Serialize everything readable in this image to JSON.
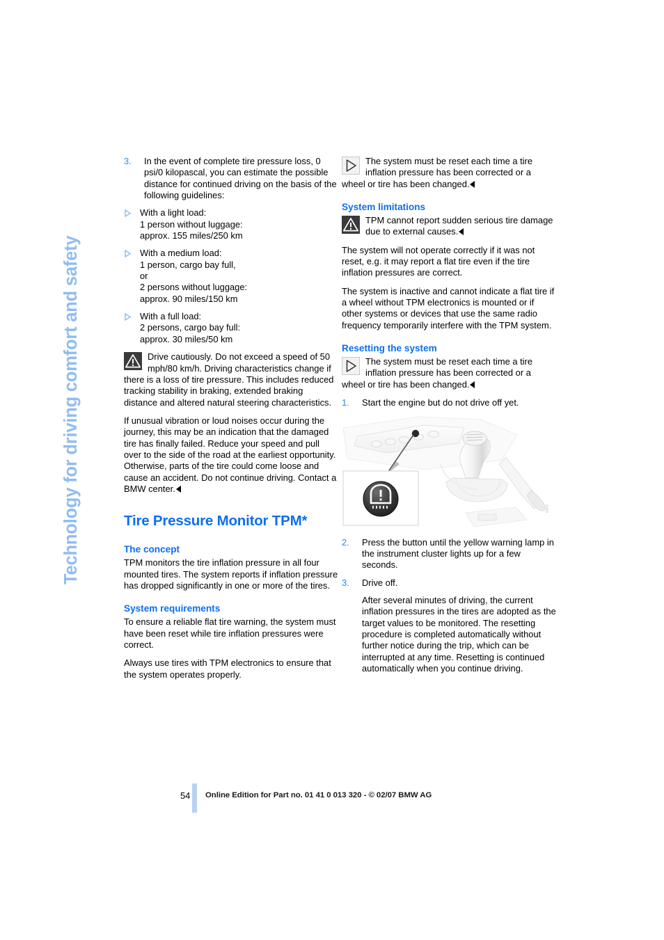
{
  "page": {
    "side_running_head": "Technology for driving comfort and safety",
    "number": "54",
    "footer": "Online Edition for Part no. 01 41 0 013 320 - © 02/07 BMW AG",
    "accent_blue": "#0d6ef0",
    "light_blue": "#8fbdf0",
    "number_blue": "#2b87f5"
  },
  "left_column": {
    "step3": {
      "number": "3.",
      "text": "In the event of complete tire pressure loss, 0 psi/0 kilopascal, you can estimate the possible distance for continued driving on the basis of the following guidelines:"
    },
    "load_cases": [
      "With a light load:\n1 person without luggage:\napprox. 155 miles/250 km",
      "With a medium load:\n1 person, cargo bay full,\nor\n2 persons without luggage:\napprox. 90 miles/150 km",
      "With a full load:\n2 persons, cargo bay full:\napprox. 30 miles/50 km"
    ],
    "warning": "Drive cautiously. Do not exceed a speed of 50 mph/80 km/h. Driving characteristics change if there is a loss of tire pressure. This includes reduced tracking stability in braking, extended braking distance and altered natural steering characteristics.",
    "warning_2": "If unusual vibration or loud noises occur during the journey, this may be an indication that the damaged tire has finally failed. Reduce your speed and pull over to the side of the road at the earliest opportunity. Otherwise, parts of the tire could come loose and cause an accident. Do not continue driving. Contact a BMW center.",
    "section_title": "Tire Pressure Monitor TPM*",
    "concept_heading": "The concept",
    "concept_text": "TPM monitors the tire inflation pressure in all four mounted tires. The system reports if inflation pressure has dropped significantly in one or more of the tires.",
    "requirements_heading": "System requirements",
    "requirements_text_1": "To ensure a reliable flat tire warning, the system must have been reset while tire inflation pressures were correct.",
    "requirements_text_2": "Always use tires with TPM electronics to ensure that the system operates properly."
  },
  "right_column": {
    "note_top": "The system must be reset each time a tire inflation pressure has been corrected or a wheel or tire has been changed.",
    "limitations_heading": "System limitations",
    "limitations_warning": "TPM cannot report sudden serious tire damage due to external causes.",
    "limitations_text_1": "The system will not operate correctly if it was not reset, e.g. it may report a flat tire even if the tire inflation pressures are correct.",
    "limitations_text_2": "The system is inactive and cannot indicate a flat tire if a wheel without TPM electronics is mounted or if other systems or devices that use the same radio frequency temporarily interfere with the TPM system.",
    "resetting_heading": "Resetting the system",
    "note_reset": "The system must be reset each time a tire inflation pressure has been corrected or a wheel or tire has been changed.",
    "step1": {
      "number": "1.",
      "text": "Start the engine but do not drive off yet."
    },
    "figure_caption": "",
    "step2": {
      "number": "2.",
      "text": "Press the button until the yellow warning lamp in the instrument cluster lights up for a few seconds."
    },
    "step3": {
      "number": "3.",
      "text": "Drive off."
    },
    "step3_body": "After several minutes of driving, the current inflation pressures in the tires are adopted as the target values to be monitored. The resetting procedure is completed automatically without further notice during the trip, which can be interrupted at any time. Resetting is continued automatically when you continue driving."
  }
}
